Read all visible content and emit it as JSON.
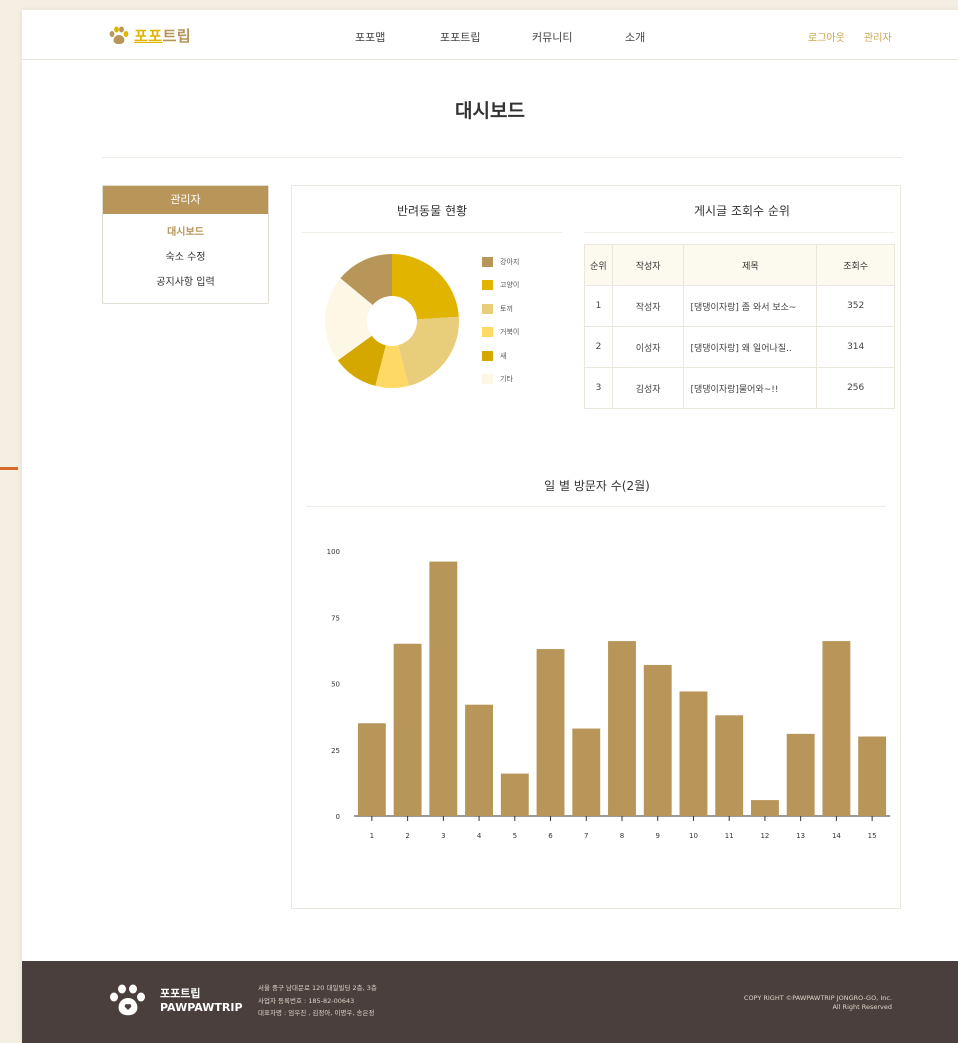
{
  "header": {
    "logo_text_a": "포포",
    "logo_text_b": "트립",
    "nav": [
      "포포맵",
      "포포트립",
      "커뮤니티",
      "소개"
    ],
    "logout_label": "로그아웃",
    "admin_label": "관리자"
  },
  "page_title": "대시보드",
  "sidebar": {
    "heading": "관리자",
    "items": [
      {
        "label": "대시보드",
        "active": true
      },
      {
        "label": "숙소 수정",
        "active": false
      },
      {
        "label": "공지사항 입력",
        "active": false
      }
    ]
  },
  "pets_section": {
    "title": "반려동물 현황",
    "colors": {
      "accent": "#b89558",
      "brand_yellow": "#e1b400"
    }
  },
  "ranking_section": {
    "title": "게시글 조회수 순위",
    "headers": [
      "순위",
      "작성자",
      "제목",
      "조회수"
    ],
    "rows": [
      [
        "1",
        "작성자",
        "[댕댕이자랑] 좀 와서 보소~",
        "352"
      ],
      [
        "2",
        "이성자",
        "[댕댕이자랑] 왜 일어나질..",
        "314"
      ],
      [
        "3",
        "김성자",
        "[댕댕이자랑]물어와~!!",
        "256"
      ]
    ]
  },
  "visitors_section": {
    "title": "일 별 방문자 수(2월)"
  },
  "chart_data": [
    {
      "type": "pie",
      "title": "",
      "categories": [
        "강아지",
        "고양이",
        "토끼",
        "거북이",
        "새",
        "기타"
      ],
      "values": [
        14,
        24,
        22,
        8,
        11,
        21
      ],
      "colors": [
        "#b89558",
        "#e1b400",
        "#e8cd7a",
        "#ffd966",
        "#d4a800",
        "#fdf8e6"
      ],
      "legend": "right"
    },
    {
      "type": "bar",
      "title": "",
      "categories": [
        "1",
        "2",
        "3",
        "4",
        "5",
        "6",
        "7",
        "8",
        "9",
        "10",
        "11",
        "12",
        "13",
        "14",
        "15"
      ],
      "values": [
        35,
        65,
        96,
        42,
        16,
        63,
        33,
        66,
        57,
        47,
        38,
        6,
        31,
        66,
        30
      ],
      "ylim": [
        0,
        100
      ],
      "yticks": [
        0,
        25,
        50,
        75,
        100
      ],
      "color": "#b89558",
      "grid": false
    }
  ],
  "footer": {
    "name_kor": "포포트립",
    "name_eng": "PAWPAWTRIP",
    "info": [
      "서울 중구 남대문로 120 대일빌딩 2층, 3층",
      "사업자 등록번호 : 185-82-00643",
      "대표자명 : 엄우진 , 김정아, 이명우, 송은정"
    ],
    "copy": [
      "COPY RIGHT ©PAWPAWTRIP JONGRO-GO, Inc.",
      "All Right Reserved"
    ]
  }
}
